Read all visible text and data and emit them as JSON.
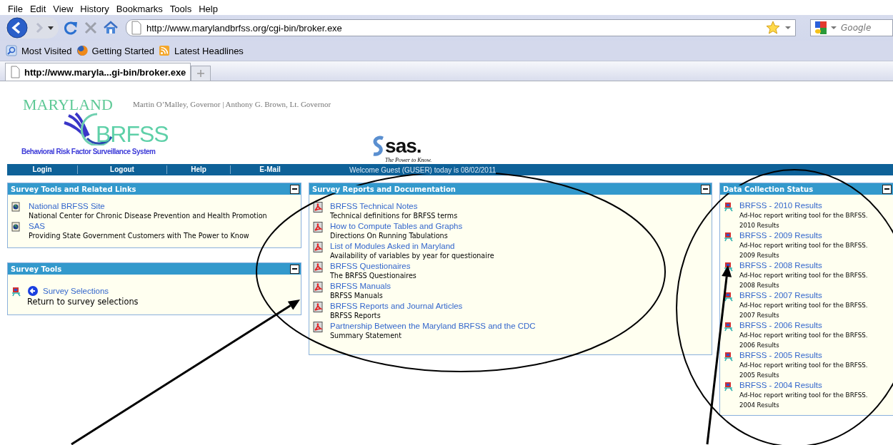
{
  "browser": {
    "menu": [
      "File",
      "Edit",
      "View",
      "History",
      "Bookmarks",
      "Tools",
      "Help"
    ],
    "url": "http://www.marylandbrfss.org/cgi-bin/broker.exe",
    "search": {
      "placeholder": "Google"
    },
    "bookmarks": [
      {
        "label": "Most Visited",
        "kind": "search"
      },
      {
        "label": "Getting Started",
        "kind": "firefox"
      },
      {
        "label": "Latest Headlines",
        "kind": "rss"
      }
    ],
    "tabs": [
      {
        "label": "http://www.maryla...gi-bin/broker.exe",
        "selected": true
      }
    ]
  },
  "header": {
    "state_logo": "MARYLAND",
    "program_logo": "BRFSS",
    "program_name": "Behavioral Risk Factor Surveillance System",
    "officials": "Martin O’Malley, Governor | Anthony G. Brown, Lt. Governor",
    "vendor_logo": "sas.",
    "vendor_tagline": "The Power to Know."
  },
  "nav": {
    "links": [
      "Login",
      "Logout",
      "Help",
      "E-Mail"
    ],
    "welcome": "Welcome Guest (GUSER) today is 08/02/2011"
  },
  "columns": [
    {
      "panels": [
        {
          "title": "Survey Tools and Related Links",
          "items": [
            {
              "kind": "globe",
              "title": "National BRFSS Site",
              "description": "National Center for Chronic Disease Prevention and Health Promotion"
            },
            {
              "kind": "globe",
              "title": "SAS",
              "description": "Providing State Government Customers with The Power to Know"
            }
          ]
        },
        {
          "title": "Survey Tools",
          "items": [
            {
              "kind": "back",
              "title": "Survey Selections",
              "description": "Return to survey selections"
            }
          ]
        }
      ]
    },
    {
      "panels": [
        {
          "title": "Survey Reports and Documentation",
          "items": [
            {
              "kind": "pdf",
              "title": "BRFSS Technical Notes",
              "description": "Technical definitions for BRFSS terms"
            },
            {
              "kind": "pdf",
              "title": "How to Compute Tables and Graphs",
              "description": "Directions On Running Tabulations"
            },
            {
              "kind": "pdf",
              "title": "List of Modules Asked in Maryland",
              "description": "Availability of variables by year for questionaire"
            },
            {
              "kind": "pdf",
              "title": "BRFSS Questionaires",
              "description": "The BRFSS Questionaires"
            },
            {
              "kind": "pdf",
              "title": "BRFSS Manuals",
              "description": "BRFSS Manuals"
            },
            {
              "kind": "pdf",
              "title": "BRFSS Reports and Journal Articles",
              "description": "BRFSS Reports"
            },
            {
              "kind": "pdf",
              "title": "Partnership Between the Maryland BRFSS and the CDC",
              "description": "Summary Statement"
            }
          ]
        }
      ]
    },
    {
      "panels": [
        {
          "title": "Data Collection Status",
          "items": [
            {
              "kind": "tool",
              "title": "BRFSS - 2010 Results",
              "description": "Ad-Hoc report writing tool for the BRFSS.",
              "note": "2010 Results"
            },
            {
              "kind": "tool",
              "title": "BRFSS - 2009 Results",
              "description": "Ad-Hoc report writing tool for the BRFSS.",
              "note": "2009 Results"
            },
            {
              "kind": "tool",
              "title": "BRFSS - 2008 Results",
              "description": "Ad-Hoc report writing tool for the BRFSS.",
              "note": "2008 Results"
            },
            {
              "kind": "tool",
              "title": "BRFSS - 2007 Results",
              "description": "Ad-Hoc report writing tool for the BRFSS.",
              "note": "2007 Results"
            },
            {
              "kind": "tool",
              "title": "BRFSS - 2006 Results",
              "description": "Ad-Hoc report writing tool for the BRFSS.",
              "note": "2006 Results"
            },
            {
              "kind": "tool",
              "title": "BRFSS - 2005 Results",
              "description": "Ad-Hoc report writing tool for the BRFSS.",
              "note": "2005 Results"
            },
            {
              "kind": "tool",
              "title": "BRFSS - 2004 Results",
              "description": "Ad-Hoc report writing tool for the BRFSS.",
              "note": "2004 Results"
            }
          ]
        }
      ]
    }
  ],
  "annotations": [
    {
      "kind": "ellipse"
    },
    {
      "kind": "ellipse"
    },
    {
      "kind": "arrow"
    },
    {
      "kind": "arrow"
    }
  ]
}
